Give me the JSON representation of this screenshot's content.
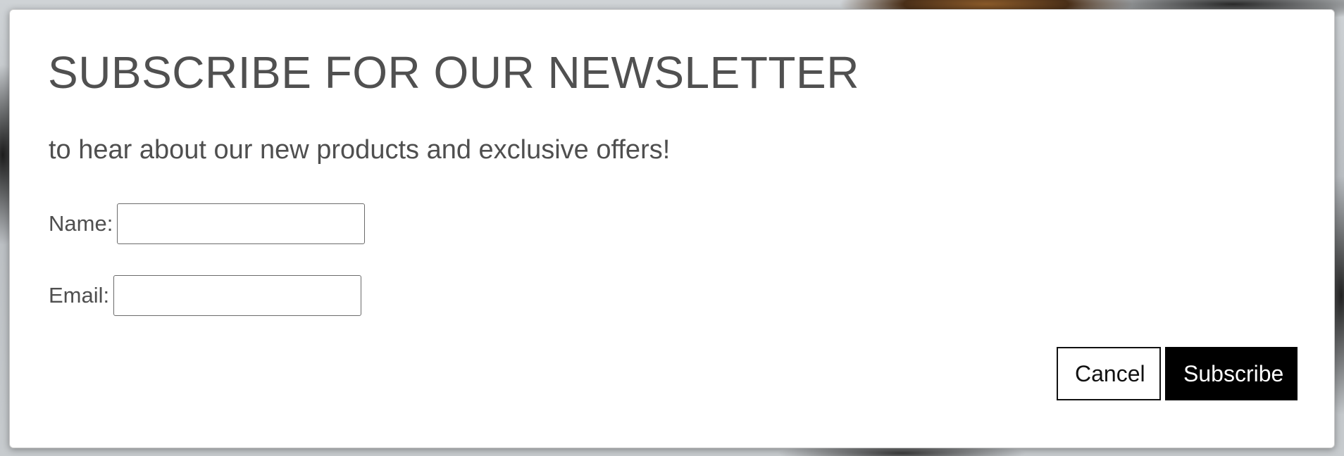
{
  "dialog": {
    "title": "SUBSCRIBE FOR OUR NEWSLETTER",
    "subtitle": "to hear about our new products and exclusive offers!",
    "fields": {
      "name": {
        "label": "Name:",
        "value": "",
        "placeholder": ""
      },
      "email": {
        "label": "Email:",
        "value": "",
        "placeholder": ""
      }
    },
    "buttons": {
      "cancel_label": "Cancel",
      "subscribe_label": "Subscribe"
    }
  },
  "colors": {
    "title_text": "#505050",
    "body_text": "#4f4f4f",
    "primary_button_bg": "#000000",
    "primary_button_text": "#ffffff",
    "secondary_button_bg": "#ffffff",
    "secondary_button_border": "#111111"
  }
}
